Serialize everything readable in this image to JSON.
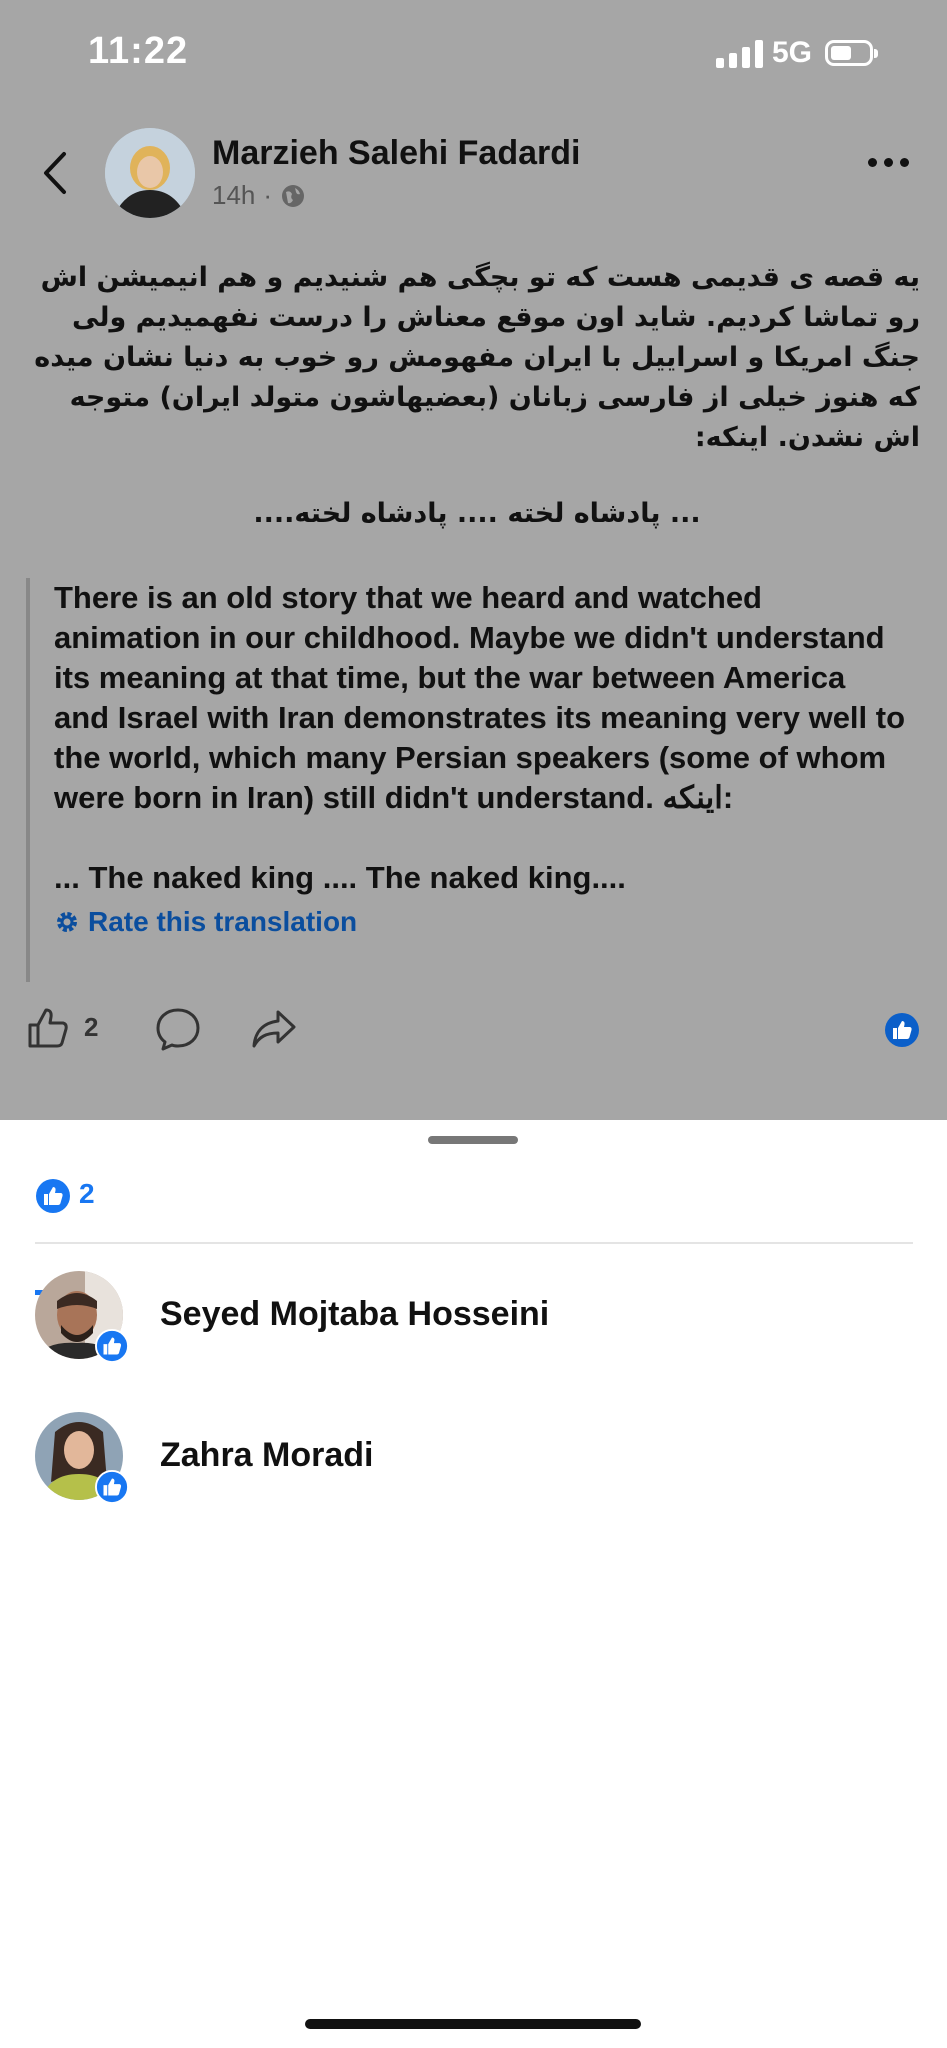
{
  "status_bar": {
    "time": "11:22",
    "network": "5G"
  },
  "post": {
    "author": "Marzieh Salehi Fadardi",
    "time_ago": "14h",
    "separator": "·",
    "original_text": "یه قصه ی قدیمی هست که تو بچگی هم شنیدیم و هم انیمیشن اش رو تماشا کردیم. شاید اون موقع معناش را درست نفهمیدیم ولی جنگ امریکا و اسراییل با ایران مفهومش رو خوب به دنیا نشان میده که هنوز خیلی از فارسی زبانان (بعضیهاشون متولد ایران) متوجه اش نشدن. اینکه:",
    "original_quote": "... پادشاه لخته .... پادشاه لخته....",
    "translation_text": "There is an old story that we heard and watched animation in our childhood. Maybe we didn't understand its meaning at that time, but the war between America and Israel with Iran demonstrates its meaning very well to the world, which many Persian speakers (some of whom were born in Iran) still didn't understand. اینکه:",
    "translation_quote": "... The naked king .... The naked king....",
    "rate_label": "Rate this translation",
    "like_count": "2"
  },
  "reactions_sheet": {
    "tab_count": "2",
    "people": [
      {
        "name": "Seyed Mojtaba Hosseini"
      },
      {
        "name": "Zahra Moradi"
      }
    ]
  },
  "colors": {
    "brand_blue": "#1877f2",
    "dim_overlay": "#a6a6a6",
    "link_blue": "#0b4e9e"
  },
  "icons": {
    "back": "chevron-left-icon",
    "globe": "globe-icon",
    "more": "more-horizontal-icon",
    "gear": "gear-icon",
    "like": "thumbs-up-icon",
    "comment": "comment-icon",
    "share": "share-icon",
    "like_badge": "like-reaction-icon"
  }
}
